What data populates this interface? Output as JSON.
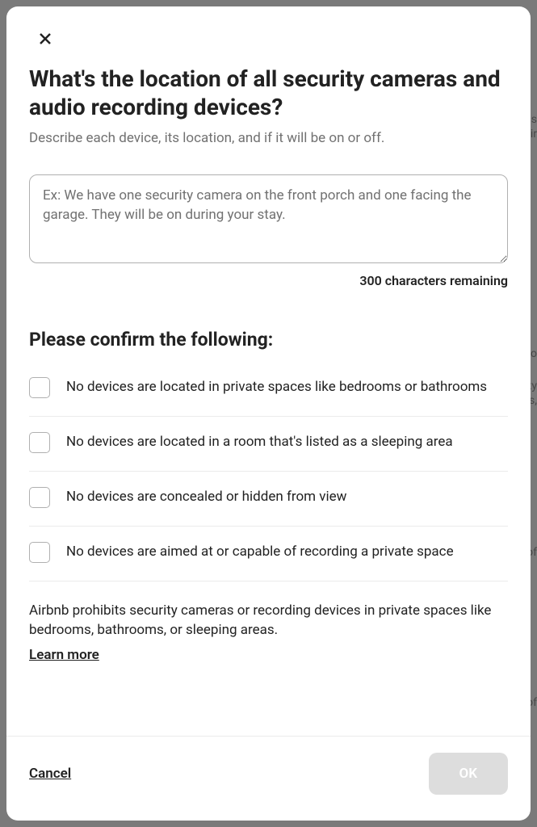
{
  "modal": {
    "title": "What's the location of all security cameras and audio recording devices?",
    "subtitle": "Describe each device, its location, and if it will be on or off.",
    "textarea": {
      "placeholder": "Ex: We have one security camera on the front porch and one facing the garage. They will be on during your stay.",
      "value": ""
    },
    "charCounter": "300 characters remaining",
    "confirmHeading": "Please confirm the following:",
    "checkboxes": [
      {
        "label": "No devices are located in private spaces like bedrooms or bathrooms"
      },
      {
        "label": "No devices are located in a room that's listed as a sleeping area"
      },
      {
        "label": "No devices are concealed or hidden from view"
      },
      {
        "label": "No devices are aimed at or capable of recording a private space"
      }
    ],
    "policyText": "Airbnb prohibits security cameras or recording devices in private spaces like bedrooms, bathrooms, or sleeping areas.",
    "learnMore": "Learn more",
    "cancel": "Cancel",
    "ok": "OK"
  },
  "background": {
    "snippets": [
      "mals",
      "untair",
      "s to",
      "ity",
      "oms,",
      "e of",
      "e of"
    ]
  }
}
